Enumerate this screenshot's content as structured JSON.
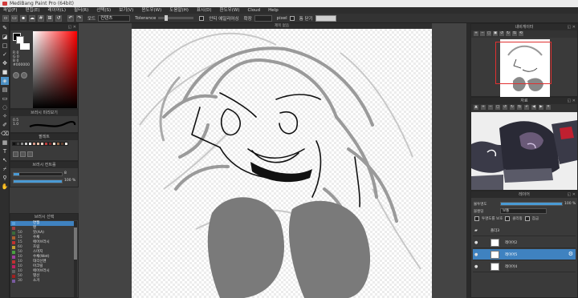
{
  "window": {
    "title": "MediBang Paint Pro (64bit)"
  },
  "menu": [
    "파일(F)",
    "편집(E)",
    "레이어(L)",
    "필터(R)",
    "선택(S)",
    "보기(V)",
    "윈도우(W)",
    "도움말(H)",
    "표시(D)",
    "환도우(W)",
    "Cloud",
    "Help"
  ],
  "toolbar": {
    "mode_label": "모드",
    "mode_value": "컨텐츠",
    "tolerance_label": "Tolerance",
    "antialias_label": "안티 에일리어싱",
    "expand_label": "확장",
    "expand_unit": "pixel",
    "close_label": "틈 닫기"
  },
  "color_panel": {
    "r": "R 0",
    "g": "G 0",
    "b": "B 0",
    "hex": "#000000"
  },
  "brush_preview": {
    "title": "브러시 미리보기",
    "sizes": [
      "0.5",
      "1.0",
      "1.5"
    ]
  },
  "palette": {
    "title": "팔레트",
    "colors": [
      "#111111",
      "#444444",
      "#888888",
      "#cccccc",
      "#ffffff",
      "#d89a8a",
      "#e8c0a8",
      "#f0d8c8",
      "#c04040",
      "#803030",
      "#f4e4d4",
      "#a07050",
      "#604030",
      "#f8f0e8"
    ]
  },
  "brush_control": {
    "title": "브러시 컨트롤",
    "size_value": "8",
    "opacity_value": "100 %",
    "size_fill": 0.12,
    "opacity_fill": 1.0
  },
  "brush_list": {
    "title": "브러시 선택",
    "items": [
      {
        "size": "",
        "name": "연필",
        "color": "#5aa0d8",
        "selected": true
      },
      {
        "size": "",
        "name": "펜",
        "color": "#a44040"
      },
      {
        "size": "50",
        "name": "붓(AA)",
        "color": "#3a6a3a"
      },
      {
        "size": "15",
        "name": "수채",
        "color": "#aa6030"
      },
      {
        "size": "15",
        "name": "에어브러시",
        "color": "#c03030"
      },
      {
        "size": "60",
        "name": "흐림",
        "color": "#c0a030"
      },
      {
        "size": "50",
        "name": "스머지",
        "color": "#4aa040"
      },
      {
        "size": "10",
        "name": "수채(Wet)",
        "color": "#a040a0"
      },
      {
        "size": "10",
        "name": "대각선펜",
        "color": "#c03030"
      },
      {
        "size": "10",
        "name": "아크릴",
        "color": "#c02060"
      },
      {
        "size": "10",
        "name": "에어브러시",
        "color": "#606060"
      },
      {
        "size": "50",
        "name": "별선",
        "color": "#a02020"
      },
      {
        "size": "30",
        "name": "소거",
        "color": "#7a5aa0"
      }
    ]
  },
  "canvas": {
    "title": "제목 없음"
  },
  "navigator": {
    "title": "내비게이터"
  },
  "reference": {
    "title": "자료"
  },
  "layers": {
    "title": "레이어",
    "opacity_label": "불투명도",
    "opacity_value": "100 %",
    "blend_label": "블렌딩",
    "blend_value": "보통",
    "protect_label": "투명도를 보호",
    "clip_label": "클리핑",
    "lock_label": "잠금",
    "folder": "폴더3",
    "items": [
      {
        "name": "레이어2",
        "selected": false
      },
      {
        "name": "레이어5",
        "selected": true
      },
      {
        "name": "레이어4",
        "selected": false
      }
    ]
  }
}
